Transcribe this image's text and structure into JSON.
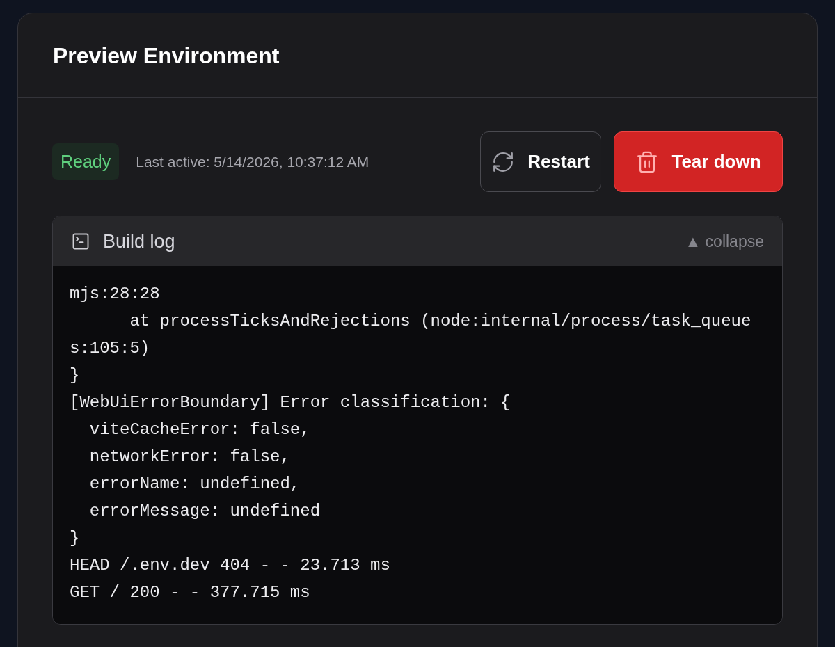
{
  "card": {
    "title": "Preview Environment"
  },
  "status": {
    "label": "Ready",
    "kind": "ready"
  },
  "last_active": "Last active: 5/14/2026, 10:37:12 AM",
  "buttons": [
    {
      "label": "Restart",
      "kind": "restart"
    },
    {
      "label": "Tear down",
      "kind": "danger"
    }
  ],
  "log": {
    "title": "Build log",
    "toggle": "▲ collapse",
    "expanded": true,
    "lines": [
      "mjs:28:28",
      "      at processTicksAndRejections (node:internal/process/task_queue",
      "s:105:5)",
      "}",
      "[WebUiErrorBoundary] Error classification: {",
      "  viteCacheError: false,",
      "  networkError: false,",
      "  errorName: undefined,",
      "  errorMessage: undefined",
      "}",
      "HEAD /.env.dev 404 - - 23.713 ms",
      "GET / 200 - - 377.715 ms"
    ]
  }
}
